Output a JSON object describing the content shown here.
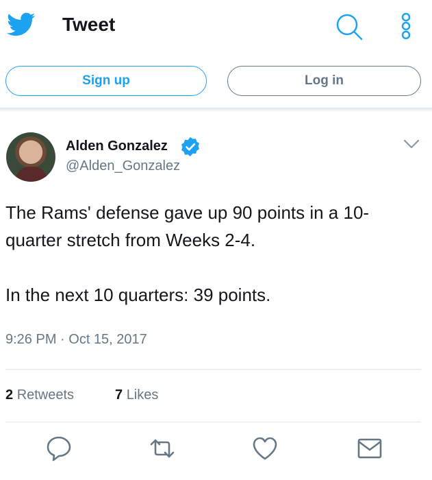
{
  "header": {
    "title": "Tweet"
  },
  "auth": {
    "signup_label": "Sign up",
    "login_label": "Log in"
  },
  "tweet": {
    "author_name": "Alden Gonzalez",
    "author_handle": "@Alden_Gonzalez",
    "text": "The Rams' defense gave up 90 points in a 10-quarter stretch from Weeks 2-4.\n\nIn the next 10 quarters: 39 points.",
    "timestamp": "9:26 PM · Oct 15, 2017",
    "retweets_count": "2",
    "retweets_label": "Retweets",
    "likes_count": "7",
    "likes_label": "Likes"
  },
  "colors": {
    "brand": "#1da1f2",
    "muted": "#657786",
    "text": "#14171a"
  },
  "icons": [
    "twitter-bird-icon",
    "search-icon",
    "more-vertical-icon",
    "verified-badge-icon",
    "chevron-down-icon",
    "reply-icon",
    "retweet-icon",
    "like-icon",
    "message-icon"
  ]
}
